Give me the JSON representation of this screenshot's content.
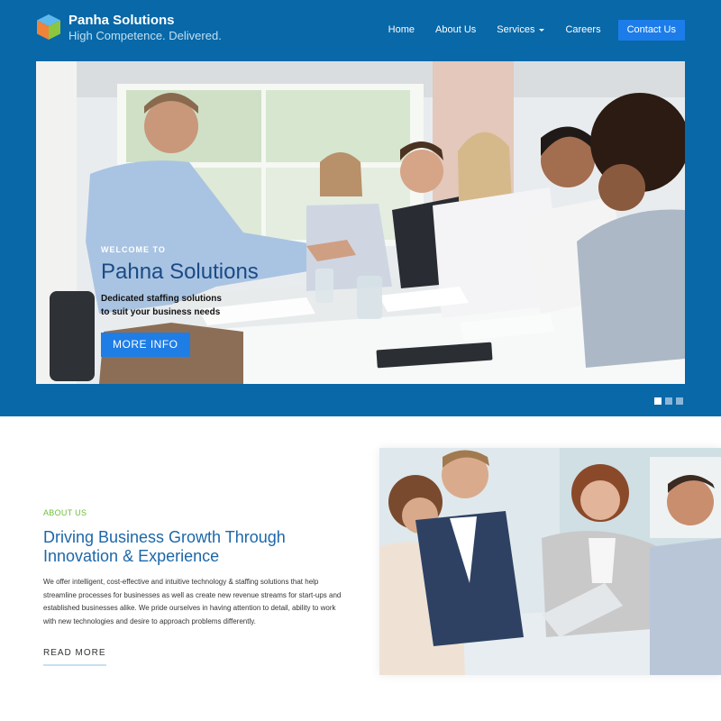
{
  "header": {
    "brand_name": "Panha Solutions",
    "tagline": "High Competence. Delivered.",
    "logo_icon": "cube-logo-icon",
    "nav": [
      {
        "label": "Home"
      },
      {
        "label": "About Us"
      },
      {
        "label": "Services",
        "has_dropdown": true
      },
      {
        "label": "Careers"
      }
    ],
    "contact_label": "Contact Us"
  },
  "hero": {
    "welcome": "WELCOME TO",
    "title": "Pahna Solutions",
    "subtitle_line1": "Dedicated staffing solutions",
    "subtitle_line2": "to suit your business needs",
    "button_label": "MORE INFO",
    "slides": 3,
    "active_slide": 1
  },
  "about": {
    "eyebrow": "ABOUT US",
    "title": "Driving Business Growth Through Innovation & Experience",
    "body": "We offer intelligent, cost-effective and intuitive technology & staffing solutions that help streamline processes for businesses as well as create new revenue streams for start-ups and established businesses alike. We pride ourselves in having attention to detail, ability to work with new technologies and desire to approach problems differently.",
    "read_more": "READ MORE"
  },
  "colors": {
    "band": "#0868a8",
    "accent_button": "#1c7cea",
    "title_blue": "#1d67a8",
    "eyebrow_green": "#6cbf3a"
  }
}
